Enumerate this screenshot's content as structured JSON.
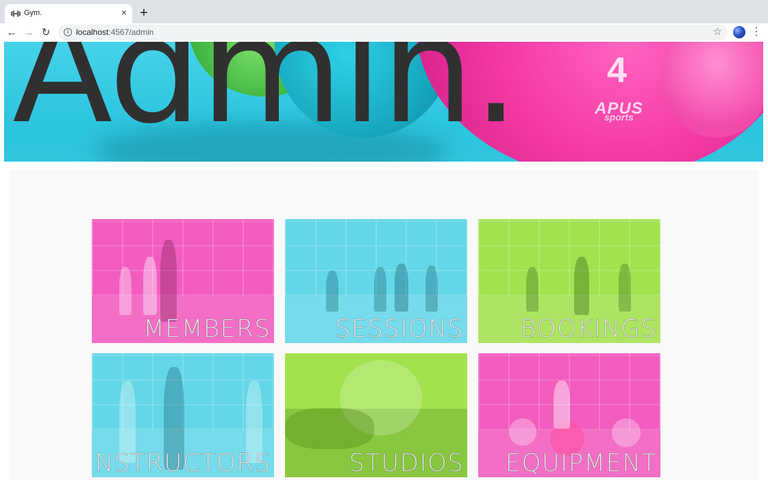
{
  "browser": {
    "tab_title": "Gym.",
    "tab_close": "×",
    "new_tab": "+",
    "url_host": "localhost",
    "url_rest": ":4567/admin",
    "back": "←",
    "forward": "→",
    "reload": "↻",
    "info": "i",
    "star": "☆",
    "menu": "⋮"
  },
  "hero": {
    "title": "Admin.",
    "image_brand_number": "4",
    "image_brand_name": "APUS",
    "image_brand_sub": "sports"
  },
  "tiles": [
    {
      "label": "MEMBERS",
      "color": "#f25cbf"
    },
    {
      "label": "SESSIONS",
      "color": "#63d7e7"
    },
    {
      "label": "BOOKINGS",
      "color": "#a2e24e"
    },
    {
      "label": "INSTRUCTORS",
      "color": "#63d7e7"
    },
    {
      "label": "STUDIOS",
      "color": "#a2e24e"
    },
    {
      "label": "EQUIPMENT",
      "color": "#f25cbf"
    }
  ],
  "colors": {
    "pink": "#f25cbf",
    "cyan": "#63d7e7",
    "lime": "#a2e24e",
    "title_text": "#303030"
  }
}
